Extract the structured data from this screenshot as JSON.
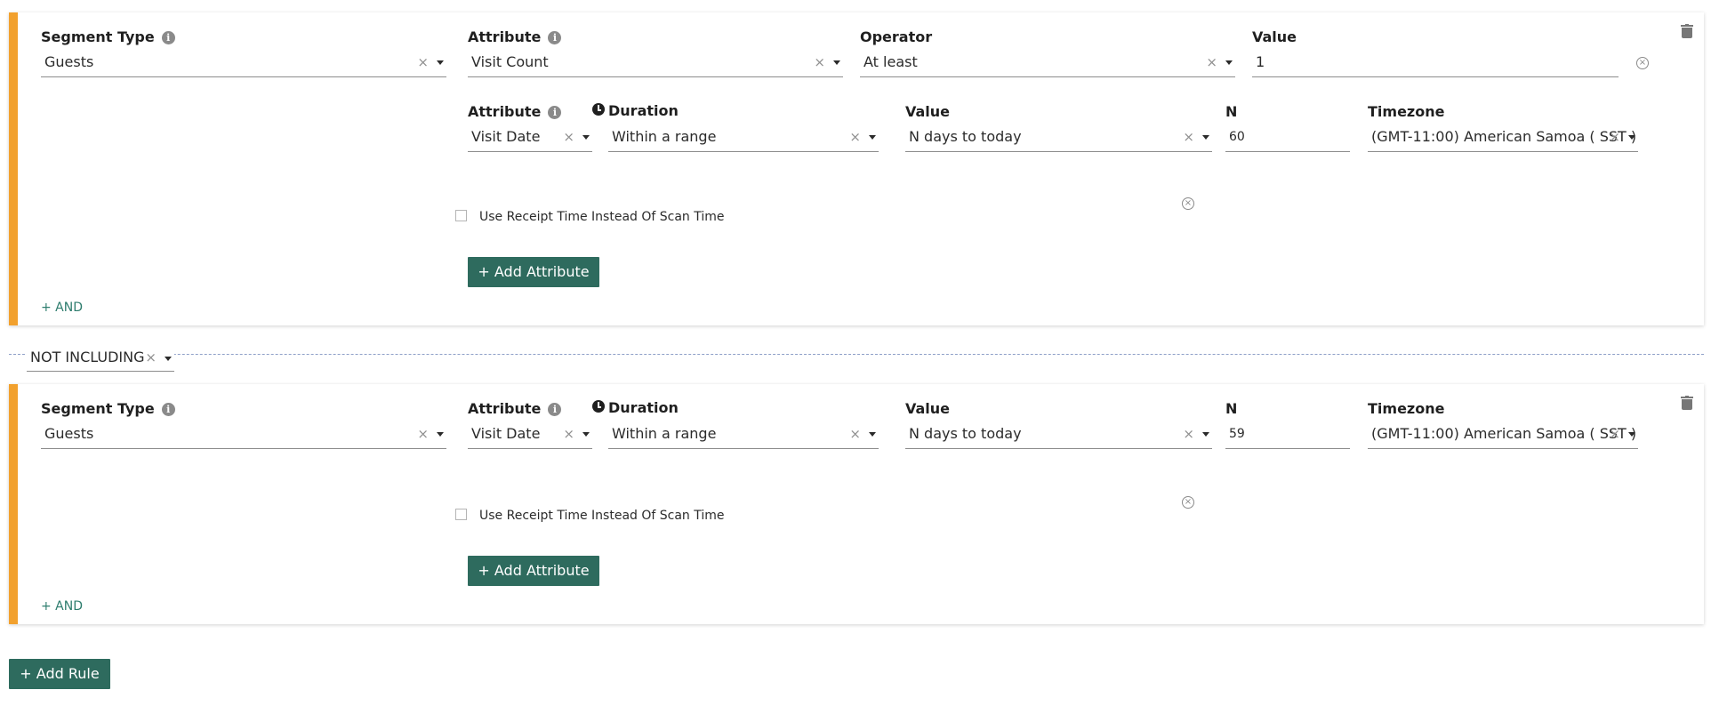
{
  "rule1": {
    "segment_type": {
      "label": "Segment Type",
      "value": "Guests"
    },
    "attr_row1": {
      "attribute": {
        "label": "Attribute",
        "value": "Visit Count"
      },
      "operator": {
        "label": "Operator",
        "value": "At least"
      },
      "value": {
        "label": "Value",
        "value": "1"
      }
    },
    "attr_row2": {
      "attribute": {
        "label": "Attribute",
        "value": "Visit Date"
      },
      "duration": {
        "label": "Duration",
        "value": "Within a range"
      },
      "value": {
        "label": "Value",
        "value": "N days to today"
      },
      "n": {
        "label": "N",
        "value": "60"
      },
      "timezone": {
        "label": "Timezone",
        "value": "(GMT-11:00) American Samoa ( SST )"
      }
    },
    "receipt_checkbox_label": "Use Receipt Time Instead Of Scan Time",
    "add_attribute_label": "+ Add Attribute",
    "and_label": "+ AND"
  },
  "join": {
    "value": "NOT INCLUDING"
  },
  "rule2": {
    "segment_type": {
      "label": "Segment Type",
      "value": "Guests"
    },
    "attr_row1": {
      "attribute": {
        "label": "Attribute",
        "value": "Visit Date"
      },
      "duration": {
        "label": "Duration",
        "value": "Within a range"
      },
      "value": {
        "label": "Value",
        "value": "N days to today"
      },
      "n": {
        "label": "N",
        "value": "59"
      },
      "timezone": {
        "label": "Timezone",
        "value": "(GMT-11:00) American Samoa ( SST )"
      }
    },
    "receipt_checkbox_label": "Use Receipt Time Instead Of Scan Time",
    "add_attribute_label": "+ Add Attribute",
    "and_label": "+ AND"
  },
  "add_rule_label": "+ Add Rule",
  "glyphs": {
    "clear": "×",
    "remove": "×",
    "info": "i"
  },
  "colors": {
    "accent": "#f2a12e",
    "button": "#2e6b5e",
    "link": "#2e7d6e"
  }
}
